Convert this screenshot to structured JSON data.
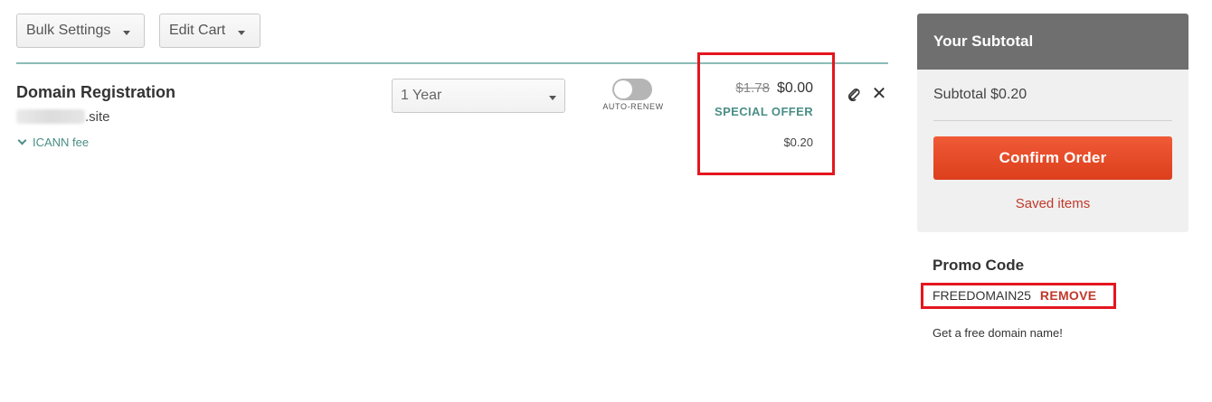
{
  "toolbar": {
    "bulk_settings_label": "Bulk Settings",
    "edit_cart_label": "Edit Cart"
  },
  "cart_item": {
    "title": "Domain Registration",
    "domain_suffix": ".site",
    "icann_fee_label": "ICANN fee",
    "period_selected": "1 Year",
    "auto_renew_label": "AUTO-RENEW",
    "auto_renew_enabled": false,
    "old_price": "$1.78",
    "price": "$0.00",
    "special_offer_label": "SPECIAL OFFER",
    "icann_fee_price": "$0.20"
  },
  "summary": {
    "header": "Your Subtotal",
    "subtotal_text": "Subtotal $0.20",
    "confirm_label": "Confirm Order",
    "saved_items_label": "Saved items"
  },
  "promo": {
    "title": "Promo Code",
    "code": "FREEDOMAIN25",
    "remove_label": "REMOVE",
    "description": "Get a free domain name!"
  },
  "colors": {
    "accent_teal": "#4a8e86",
    "confirm_orange": "#e64a26",
    "highlight_red": "#e4161f",
    "panel_header": "#6f6f6f"
  }
}
